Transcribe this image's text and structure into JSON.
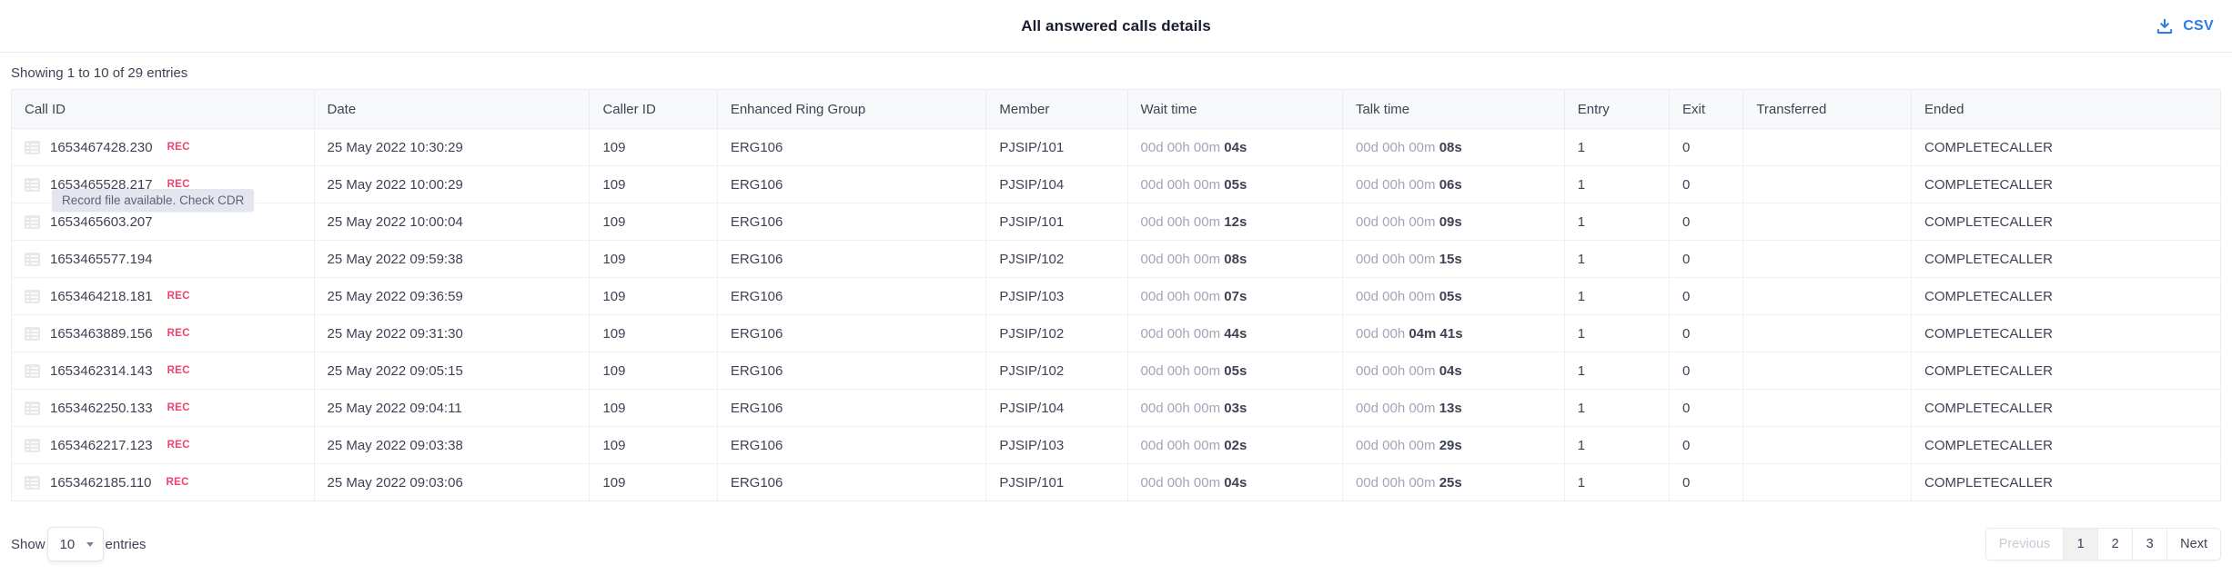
{
  "header": {
    "title": "All answered calls details",
    "csv_label": "CSV",
    "csv_icon": "download-icon",
    "accent_color": "#2b7de9"
  },
  "info": {
    "showing": "Showing 1 to 10 of 29 entries"
  },
  "table": {
    "columns": [
      "Call ID",
      "Date",
      "Caller ID",
      "Enhanced Ring Group",
      "Member",
      "Wait time",
      "Talk time",
      "Entry",
      "Exit",
      "Transferred",
      "Ended"
    ],
    "rec_badge_label": "REC",
    "rec_badge_color": "#f1416c",
    "row_icon": "list-detail-icon",
    "rows": [
      {
        "call_id": "1653467428.230",
        "rec": "REC",
        "date": "25 May 2022 10:30:29",
        "caller_id": "109",
        "erg": "ERG106",
        "member": "PJSIP/101",
        "wait_dim": "00d 00h 00m ",
        "wait_hi": "04s",
        "talk_dim": "00d 00h 00m ",
        "talk_hi": "08s",
        "entry": "1",
        "exit": "0",
        "transferred": "",
        "ended": "COMPLETECALLER"
      },
      {
        "call_id": "1653465528.217",
        "rec": "REC",
        "date": "25 May 2022 10:00:29",
        "caller_id": "109",
        "erg": "ERG106",
        "member": "PJSIP/104",
        "wait_dim": "00d 00h 00m ",
        "wait_hi": "05s",
        "talk_dim": "00d 00h 00m ",
        "talk_hi": "06s",
        "entry": "1",
        "exit": "0",
        "transferred": "",
        "ended": "COMPLETECALLER"
      },
      {
        "call_id": "1653465603.207",
        "rec": "",
        "date": "25 May 2022 10:00:04",
        "caller_id": "109",
        "erg": "ERG106",
        "member": "PJSIP/101",
        "wait_dim": "00d 00h 00m ",
        "wait_hi": "12s",
        "talk_dim": "00d 00h 00m ",
        "talk_hi": "09s",
        "entry": "1",
        "exit": "0",
        "transferred": "",
        "ended": "COMPLETECALLER"
      },
      {
        "call_id": "1653465577.194",
        "rec": "",
        "date": "25 May 2022 09:59:38",
        "caller_id": "109",
        "erg": "ERG106",
        "member": "PJSIP/102",
        "wait_dim": "00d 00h 00m ",
        "wait_hi": "08s",
        "talk_dim": "00d 00h 00m ",
        "talk_hi": "15s",
        "entry": "1",
        "exit": "0",
        "transferred": "",
        "ended": "COMPLETECALLER"
      },
      {
        "call_id": "1653464218.181",
        "rec": "REC",
        "date": "25 May 2022 09:36:59",
        "caller_id": "109",
        "erg": "ERG106",
        "member": "PJSIP/103",
        "wait_dim": "00d 00h 00m ",
        "wait_hi": "07s",
        "talk_dim": "00d 00h 00m ",
        "talk_hi": "05s",
        "entry": "1",
        "exit": "0",
        "transferred": "",
        "ended": "COMPLETECALLER"
      },
      {
        "call_id": "1653463889.156",
        "rec": "REC",
        "date": "25 May 2022 09:31:30",
        "caller_id": "109",
        "erg": "ERG106",
        "member": "PJSIP/102",
        "wait_dim": "00d 00h 00m ",
        "wait_hi": "44s",
        "talk_dim": "00d 00h ",
        "talk_hi": "04m 41s",
        "entry": "1",
        "exit": "0",
        "transferred": "",
        "ended": "COMPLETECALLER"
      },
      {
        "call_id": "1653462314.143",
        "rec": "REC",
        "date": "25 May 2022 09:05:15",
        "caller_id": "109",
        "erg": "ERG106",
        "member": "PJSIP/102",
        "wait_dim": "00d 00h 00m ",
        "wait_hi": "05s",
        "talk_dim": "00d 00h 00m ",
        "talk_hi": "04s",
        "entry": "1",
        "exit": "0",
        "transferred": "",
        "ended": "COMPLETECALLER"
      },
      {
        "call_id": "1653462250.133",
        "rec": "REC",
        "date": "25 May 2022 09:04:11",
        "caller_id": "109",
        "erg": "ERG106",
        "member": "PJSIP/104",
        "wait_dim": "00d 00h 00m ",
        "wait_hi": "03s",
        "talk_dim": "00d 00h 00m ",
        "talk_hi": "13s",
        "entry": "1",
        "exit": "0",
        "transferred": "",
        "ended": "COMPLETECALLER"
      },
      {
        "call_id": "1653462217.123",
        "rec": "REC",
        "date": "25 May 2022 09:03:38",
        "caller_id": "109",
        "erg": "ERG106",
        "member": "PJSIP/103",
        "wait_dim": "00d 00h 00m ",
        "wait_hi": "02s",
        "talk_dim": "00d 00h 00m ",
        "talk_hi": "29s",
        "entry": "1",
        "exit": "0",
        "transferred": "",
        "ended": "COMPLETECALLER"
      },
      {
        "call_id": "1653462185.110",
        "rec": "REC",
        "date": "25 May 2022 09:03:06",
        "caller_id": "109",
        "erg": "ERG106",
        "member": "PJSIP/101",
        "wait_dim": "00d 00h 00m ",
        "wait_hi": "04s",
        "talk_dim": "00d 00h 00m ",
        "talk_hi": "25s",
        "entry": "1",
        "exit": "0",
        "transferred": "",
        "ended": "COMPLETECALLER"
      }
    ]
  },
  "tooltip": {
    "text": "Record file available. Check CDR"
  },
  "footer": {
    "show_label": "Show",
    "entries_label": "entries",
    "page_length": "10",
    "pagination": {
      "previous": "Previous",
      "pages": [
        "1",
        "2",
        "3"
      ],
      "active_page": "1",
      "next": "Next"
    }
  }
}
